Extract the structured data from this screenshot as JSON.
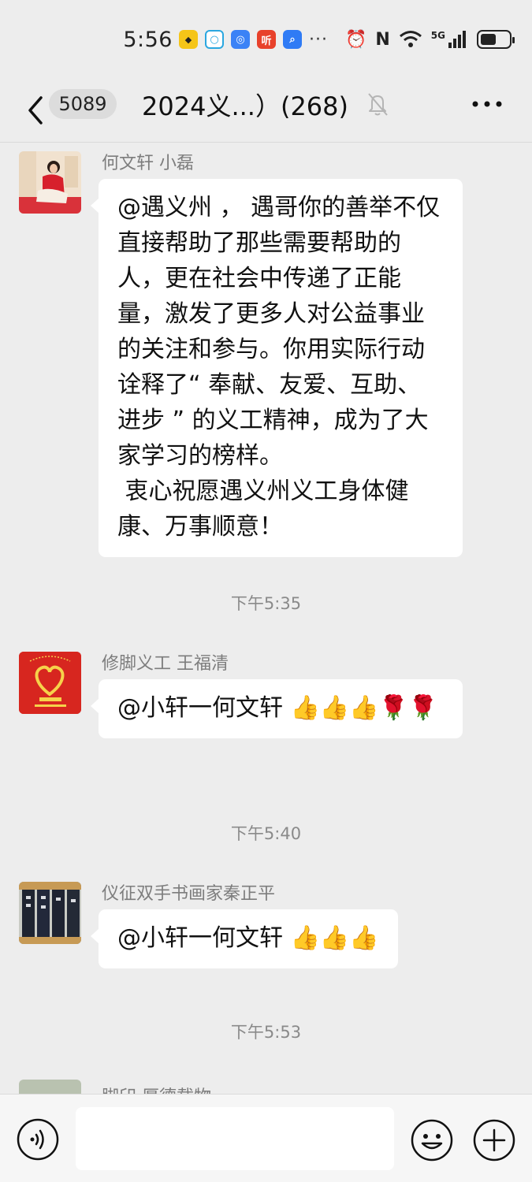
{
  "status_bar": {
    "time": "5:56",
    "app_icons": [
      "douyin-sticker-app-icon",
      "search-bubble-app-icon",
      "browser-app-icon",
      "ting-app-icon",
      "search-app-icon"
    ],
    "ting_label": "听",
    "overflow": "···",
    "network": "5G",
    "colors": {
      "ting": "#e8412b",
      "search": "#2f7bf5",
      "browser": "#3b82f6"
    }
  },
  "header": {
    "unread_count": "5089",
    "title": "2024义...）(268)"
  },
  "messages": [
    {
      "sender": "何文轩 小磊",
      "text": "@遇义州 ， 遇哥你的善举不仅直接帮助了那些需要帮助的人，更在社会中传递了正能量，激发了更多人对公益事业的关注和参与。你用实际行动诠释了“ 奉献、友爱、互助、进步 ” 的义工精神，成为了大家学习的榜样。\n 衷心祝愿遇义州义工身体健康、万事顺意！"
    },
    {
      "sender": "修脚义工 王福清",
      "text": "@小轩一何文轩 👍👍👍🌹🌹"
    },
    {
      "sender": "仪征双手书画家秦正平",
      "text": "@小轩一何文轩 👍👍👍"
    },
    {
      "sender": "脚印 厚德载物"
    }
  ],
  "timestamps": [
    "下午5:35",
    "下午5:40",
    "下午5:53"
  ],
  "input": {
    "placeholder": ""
  }
}
